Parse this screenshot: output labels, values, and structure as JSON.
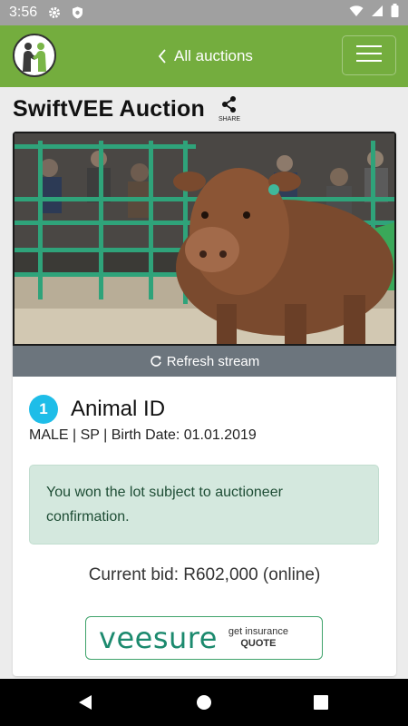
{
  "status_bar": {
    "time": "3:56",
    "icons": [
      "gear-icon",
      "shield-icon",
      "wifi-icon",
      "signal-icon",
      "battery-icon"
    ]
  },
  "app_bar": {
    "back_label": "All auctions",
    "back_icon": "chevron-left-icon",
    "menu_icon": "hamburger-menu-icon",
    "logo": "handshake-logo",
    "color": "#74ad3e"
  },
  "auction": {
    "title": "SwiftVEE Auction",
    "share_label": "SHARE"
  },
  "stream": {
    "refresh_label": "Refresh stream",
    "refresh_icon": "refresh-icon"
  },
  "lot": {
    "number": "1",
    "title": "Animal ID",
    "details": "MALE | SP | Birth Date: 01.01.2019",
    "badge_color": "#1ebde8"
  },
  "alert": {
    "message": "You won the lot subject to auctioneer confirmation."
  },
  "bid": {
    "text": "Current bid: R602,000 (online)"
  },
  "ad": {
    "brand": "veesure",
    "cta_line1": "get insurance",
    "cta_line2": "QUOTE"
  },
  "nav_bar": {
    "icons": [
      "back-triangle-icon",
      "home-circle-icon",
      "recents-square-icon"
    ]
  }
}
